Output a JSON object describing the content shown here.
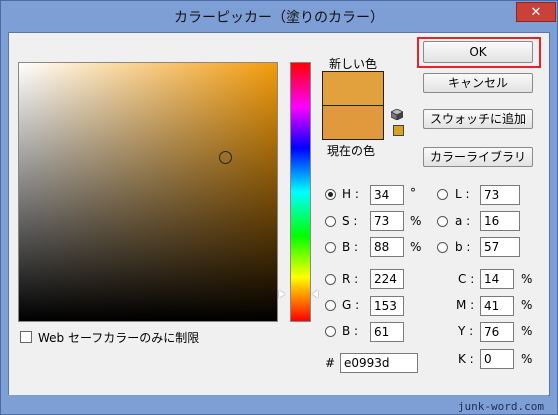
{
  "window": {
    "title": "カラーピッカー（塗りのカラー）",
    "close_glyph": "✕"
  },
  "swatches": {
    "new_label": "新しい色",
    "current_label": "現在の色",
    "new_color": "#e2a13c",
    "current_color": "#e0993d"
  },
  "buttons": {
    "ok": "OK",
    "cancel": "キャンセル",
    "add_swatch": "スウォッチに追加",
    "color_libraries": "カラーライブラリ"
  },
  "hsb": {
    "h": {
      "label": "H :",
      "value": "34",
      "unit": "°",
      "selected": true
    },
    "s": {
      "label": "S :",
      "value": "73",
      "unit": "%"
    },
    "b": {
      "label": "B :",
      "value": "88",
      "unit": "%"
    }
  },
  "rgb": {
    "r": {
      "label": "R :",
      "value": "224"
    },
    "g": {
      "label": "G :",
      "value": "153"
    },
    "b": {
      "label": "B :",
      "value": "61"
    }
  },
  "lab": {
    "l": {
      "label": "L :",
      "value": "73"
    },
    "a": {
      "label": "a :",
      "value": "16"
    },
    "b": {
      "label": "b :",
      "value": "57"
    }
  },
  "cmyk": {
    "c": {
      "label": "C :",
      "value": "14",
      "unit": "%"
    },
    "m": {
      "label": "M :",
      "value": "41",
      "unit": "%"
    },
    "y": {
      "label": "Y :",
      "value": "76",
      "unit": "%"
    },
    "k": {
      "label": "K :",
      "value": "0",
      "unit": "%"
    }
  },
  "hex": {
    "label": "#",
    "value": "e0993d"
  },
  "web_only": {
    "label": "Web セーフカラーのみに制限",
    "checked": false
  },
  "watermark": "junk-word.com",
  "colors": {
    "accent_ring": "#e8222a",
    "hue_base": "#f39b0b"
  }
}
